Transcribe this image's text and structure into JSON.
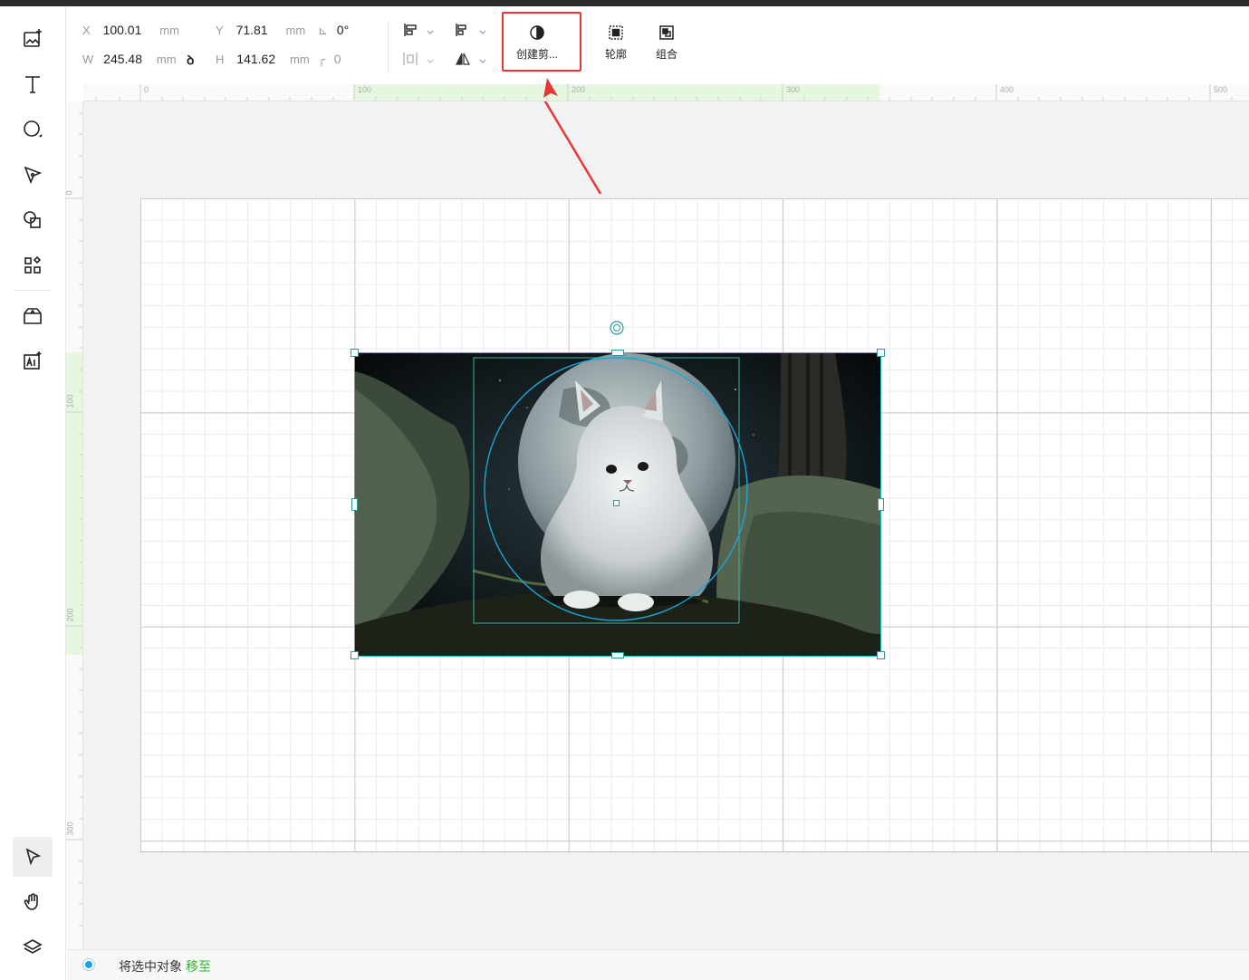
{
  "toolbar": {
    "x_label": "X",
    "x_value": "100.01",
    "x_unit": "mm",
    "y_label": "Y",
    "y_value": "71.81",
    "y_unit": "mm",
    "w_label": "W",
    "w_value": "245.48",
    "w_unit": "mm",
    "h_label": "H",
    "h_value": "141.62",
    "h_unit": "mm",
    "rotation_value": "0°",
    "corner_value": "0",
    "clip_label": "创建剪...",
    "outline_label": "轮廓",
    "group_label": "组合"
  },
  "ruler": {
    "h_labels": [
      "0",
      "100",
      "200",
      "300",
      "400",
      "500"
    ],
    "v_labels": [
      "0",
      "100",
      "200",
      "300"
    ]
  },
  "left_tools": [
    "add-image",
    "text",
    "ellipse",
    "pen",
    "shapes",
    "components",
    "material",
    "ai-image",
    "select",
    "hand",
    "layers"
  ],
  "status": {
    "text": "将选中对象",
    "link": "移至"
  },
  "colors": {
    "accent": "#22c1c3",
    "highlight": "#e53935",
    "ruler_selection": "#e6f7e0",
    "link": "#2eb82e",
    "status_dot": "#1aa3e8"
  }
}
